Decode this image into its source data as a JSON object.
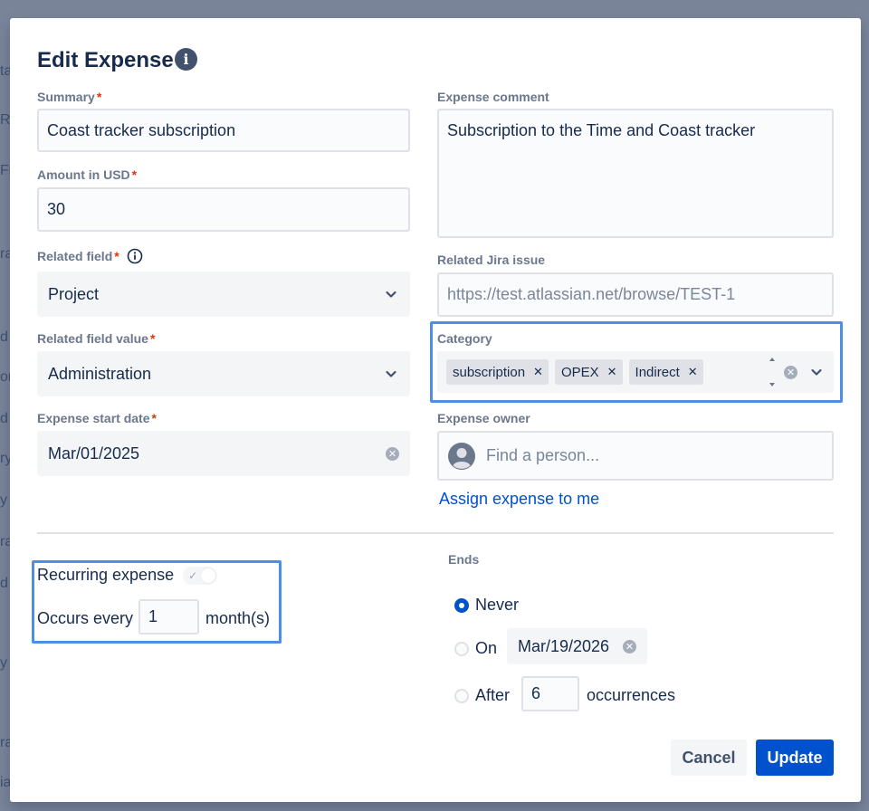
{
  "background_peek": [
    "ta",
    "Re",
    "Fi",
    "ra",
    "d",
    "or",
    "d",
    "ry",
    "y",
    "ra",
    "d",
    "y",
    "ra",
    "ia"
  ],
  "dialog": {
    "title": "Edit Expense",
    "info_icon_glyph": "i"
  },
  "form": {
    "summary": {
      "label": "Summary",
      "required": "*",
      "value": "Coast tracker subscription"
    },
    "amount": {
      "label": "Amount in USD",
      "required": "*",
      "value": "30"
    },
    "related_field": {
      "label": "Related field",
      "required": "*",
      "value": "Project"
    },
    "related_field_value": {
      "label": "Related field value",
      "required": "*",
      "value": "Administration"
    },
    "start_date": {
      "label": "Expense start date",
      "required": "*",
      "value": "Mar/01/2025"
    },
    "comment": {
      "label": "Expense comment",
      "value": "Subscription to the Time and Coast tracker"
    },
    "jira_issue": {
      "label": "Related Jira issue",
      "placeholder": "https://test.atlassian.net/browse/TEST-1"
    },
    "category": {
      "label": "Category",
      "tags": [
        {
          "label": "subscription"
        },
        {
          "label": "OPEX"
        },
        {
          "label": "Indirect"
        }
      ],
      "remove_glyph": "✕"
    },
    "owner": {
      "label": "Expense owner",
      "placeholder": "Find a person...",
      "assign_link": "Assign expense to me"
    }
  },
  "recurring": {
    "label": "Recurring expense",
    "enabled": false,
    "occurs_label": "Occurs every",
    "occurs_value": "1",
    "unit": "month(s)"
  },
  "ends": {
    "label": "Ends",
    "options": {
      "never": "Never",
      "on": "On",
      "after": "After"
    },
    "selected": "never",
    "on_date": "Mar/19/2026",
    "after_value": "6",
    "after_unit": "occurrences"
  },
  "buttons": {
    "cancel": "Cancel",
    "update": "Update"
  },
  "colors": {
    "primary": "#0052cc",
    "required": "#de350b",
    "highlight": "#4c8ee6"
  }
}
